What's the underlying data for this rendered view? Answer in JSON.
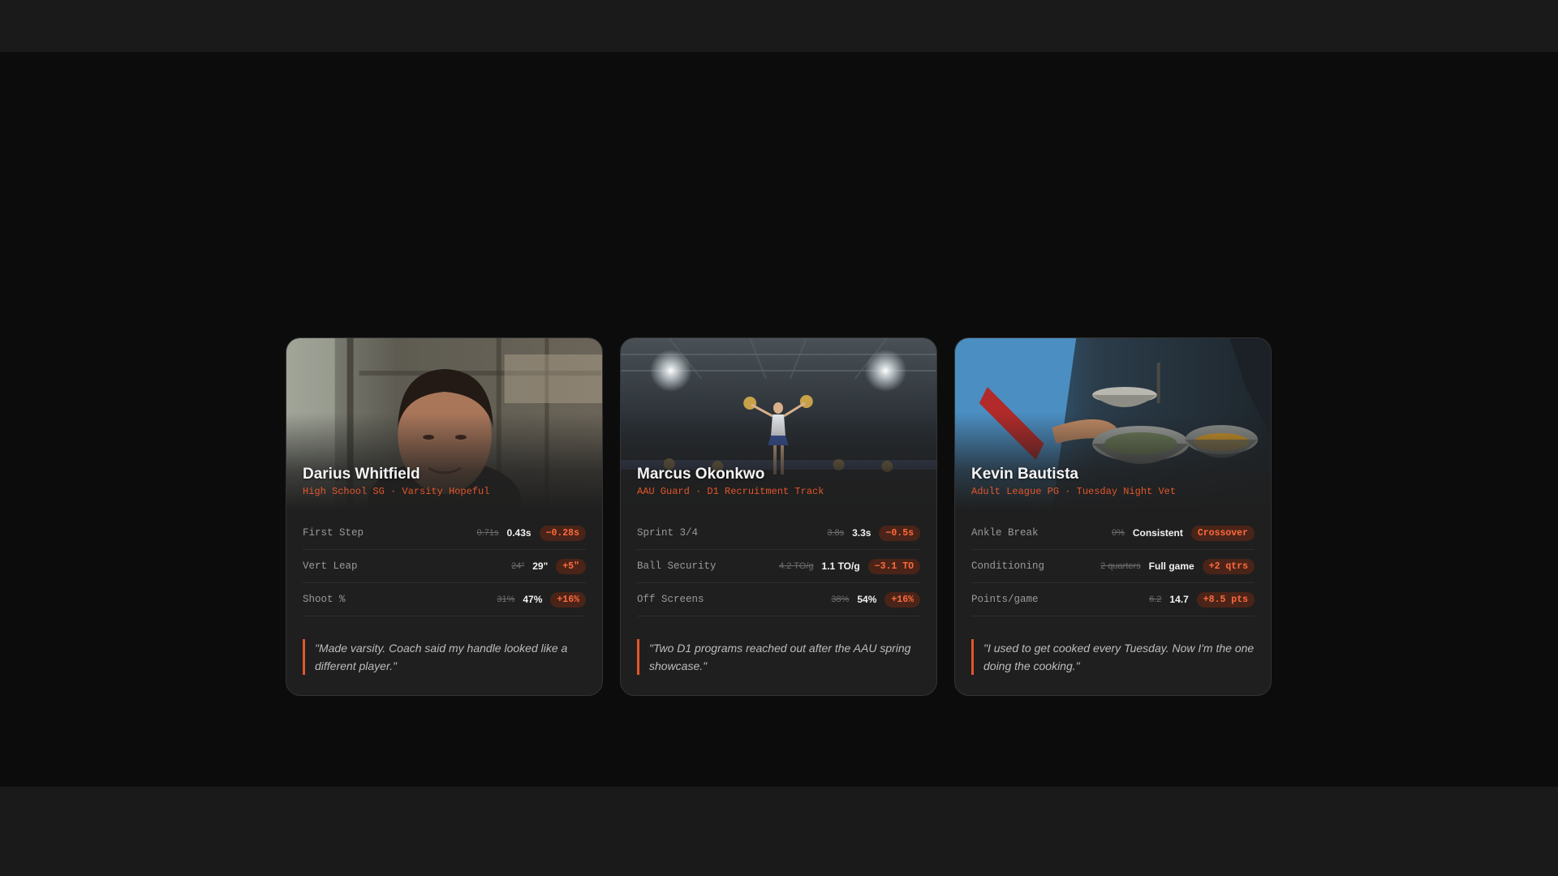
{
  "cards": [
    {
      "name": "Darius Whitfield",
      "subtitle": "High School SG · Varsity Hopeful",
      "stats": [
        {
          "label": "First Step",
          "before": "0.71s",
          "after": "0.43s",
          "delta": "−0.28s"
        },
        {
          "label": "Vert Leap",
          "before": "24\"",
          "after": "29\"",
          "delta": "+5\""
        },
        {
          "label": "Shoot %",
          "before": "31%",
          "after": "47%",
          "delta": "+16%"
        }
      ],
      "quote": "\"Made varsity. Coach said my handle looked like a different player.\""
    },
    {
      "name": "Marcus Okonkwo",
      "subtitle": "AAU Guard · D1 Recruitment Track",
      "stats": [
        {
          "label": "Sprint 3/4",
          "before": "3.8s",
          "after": "3.3s",
          "delta": "−0.5s"
        },
        {
          "label": "Ball Security",
          "before": "4.2 TO/g",
          "after": "1.1 TO/g",
          "delta": "−3.1 TO"
        },
        {
          "label": "Off Screens",
          "before": "38%",
          "after": "54%",
          "delta": "+16%"
        }
      ],
      "quote": "\"Two D1 programs reached out after the AAU spring showcase.\""
    },
    {
      "name": "Kevin Bautista",
      "subtitle": "Adult League PG · Tuesday Night Vet",
      "stats": [
        {
          "label": "Ankle Break",
          "before": "0%",
          "after": "Consistent",
          "delta": "Crossover"
        },
        {
          "label": "Conditioning",
          "before": "2 quarters",
          "after": "Full game",
          "delta": "+2 qtrs"
        },
        {
          "label": "Points/game",
          "before": "6.2",
          "after": "14.7",
          "delta": "+8.5 pts"
        }
      ],
      "quote": "\"I used to get cooked every Tuesday. Now I'm the one doing the cooking.\""
    }
  ],
  "colors": {
    "accent": "#e4562a",
    "card_bg": "#1f1f1f",
    "page_bg": "#0c0c0c",
    "band_bg": "#1a1a1a",
    "delta_bg": "#4a2418"
  }
}
